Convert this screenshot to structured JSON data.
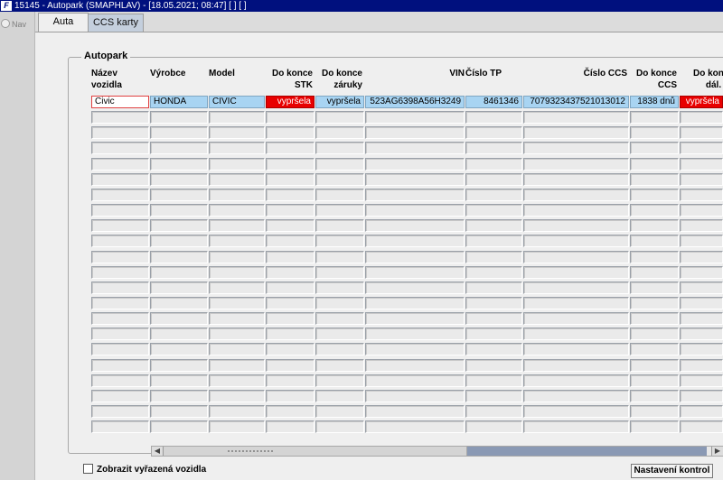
{
  "window": {
    "title": "15145 - Autopark (SMAPHLAV) - [18.05.2021; 08:47]  [ ]  [ ]",
    "logo": "F"
  },
  "nav": {
    "label": "Nav"
  },
  "tabs": [
    {
      "label": "Auta",
      "active": true
    },
    {
      "label": "CCS karty",
      "active": false
    }
  ],
  "group": {
    "title": "Autopark"
  },
  "columns": [
    {
      "label": "Název\nvozidla",
      "align": "left"
    },
    {
      "label": "Výrobce",
      "align": "left"
    },
    {
      "label": "Model",
      "align": "left"
    },
    {
      "label": "Do konce\nSTK",
      "align": "right"
    },
    {
      "label": "Do konce\nzáruky",
      "align": "right"
    },
    {
      "label": "VIN",
      "align": "right"
    },
    {
      "label": "Číslo TP",
      "align": "left"
    },
    {
      "label": "Číslo CCS",
      "align": "right"
    },
    {
      "label": "Do konce\nCCS",
      "align": "right"
    },
    {
      "label": "Do konce\ndál. zn",
      "align": "right"
    }
  ],
  "rows": [
    [
      "Civic",
      "HONDA",
      "CIVIC",
      "vypršela",
      "vypršela",
      "523AG6398A56H3249",
      "8461346",
      "7079323437521013012",
      "1838 dnů",
      "vypršela"
    ]
  ],
  "cell_status": {
    "expired_color": "#e80000",
    "selected_row_color": "#a8d4f2"
  },
  "footer": {
    "show_removed_label": "Zobrazit vyřazená vozidla",
    "show_removed_checked": false,
    "settings_button": "Nastavení kontrol"
  }
}
